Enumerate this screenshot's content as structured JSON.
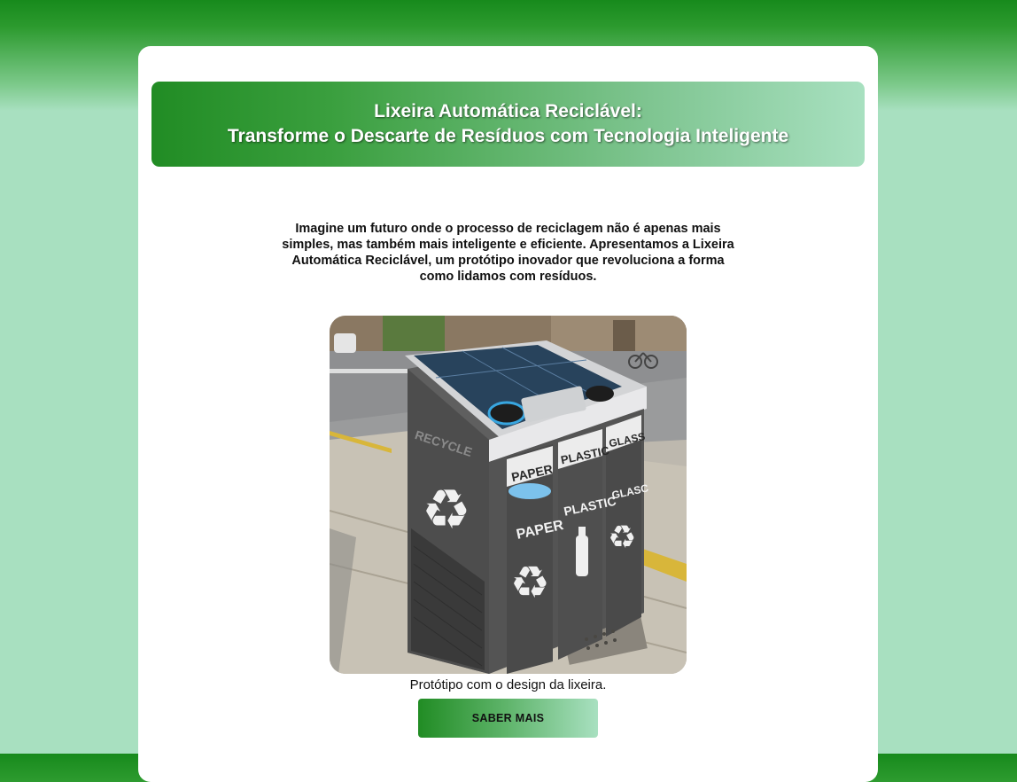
{
  "header": {
    "title_line1": "Lixeira Automática Reciclável:",
    "title_line2": "Transforme o Descarte de Resíduos com Tecnologia Inteligente"
  },
  "intro": {
    "text": "Imagine um futuro onde o processo de reciclagem não é apenas mais simples, mas também mais inteligente e eficiente. Apresentamos a Lixeira Automática Reciclável, um protótipo inovador que revoluciona a forma como lidamos com resíduos."
  },
  "figure": {
    "caption": "Protótipo com o design da lixeira.",
    "labels": {
      "side": "RECYCLE",
      "paper_top": "PAPER",
      "plastic_top": "PLASTIC",
      "glass_top": "GLASS",
      "paper_door": "PAPER",
      "plastic_door": "PLASTIC",
      "glass_door": "GLASC"
    }
  },
  "cta": {
    "label": "SABER MAIS"
  },
  "colors": {
    "accent": "#218c24",
    "accent_light": "#a8e0c0",
    "background": "#a8e0c0"
  }
}
